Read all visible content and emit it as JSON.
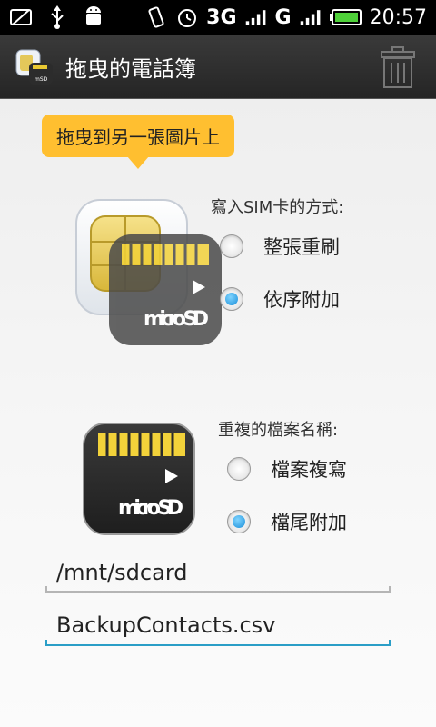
{
  "status_bar": {
    "network_label": "3G",
    "carrier_label": "G",
    "time": "20:57",
    "icons": [
      "no-sim-icon",
      "usb-icon",
      "android-debug-icon",
      "vibrate-icon",
      "alarm-icon",
      "signal-icon",
      "battery-icon"
    ]
  },
  "app_bar": {
    "title": "拖曳的電話簿",
    "icon": "app-logo-icon",
    "action_icon": "trash-icon"
  },
  "tooltip": {
    "text": "拖曳到另一張圖片上"
  },
  "sim_section": {
    "heading": "寫入SIM卡的方式:",
    "options": [
      {
        "label": "整張重刷",
        "selected": false
      },
      {
        "label": "依序附加",
        "selected": true
      }
    ]
  },
  "file_section": {
    "heading": "重複的檔案名稱:",
    "options": [
      {
        "label": "檔案複寫",
        "selected": false
      },
      {
        "label": "檔尾附加",
        "selected": true
      }
    ]
  },
  "graphics": {
    "sd_brand": "micro SD"
  },
  "inputs": {
    "path": "/mnt/sdcard",
    "filename": "BackupContacts.csv"
  },
  "colors": {
    "tooltip_bg": "#ffbf30",
    "focus_underline": "#2a9ec7",
    "underline": "#b5b5b5",
    "radio_selected": "#1b8fd9"
  }
}
